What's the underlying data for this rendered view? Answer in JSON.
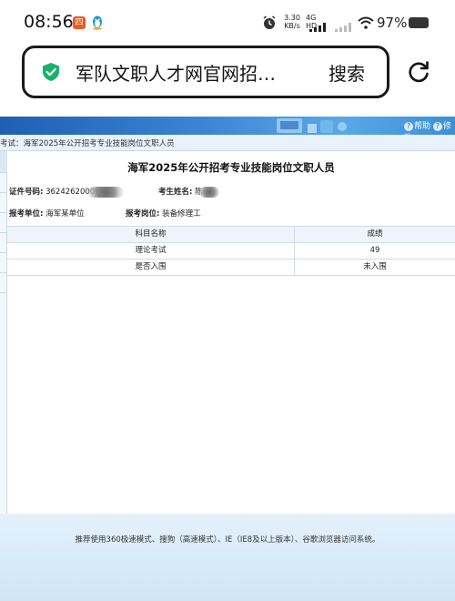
{
  "status_bar": {
    "time": "08:56",
    "app_badge_text": "四",
    "speed_value": "3.30",
    "speed_unit": "KB/s",
    "network_label": "4G HD",
    "battery_percent": "97%"
  },
  "browser": {
    "url_text": "军队文职人才网官网招…",
    "search_label": "搜索",
    "accent_color": "#18b36b"
  },
  "site": {
    "help_links": [
      "帮助",
      "修改"
    ]
  },
  "breadcrumb": {
    "text": "考试：海军2025年公开招考专业技能岗位文职人员"
  },
  "result": {
    "title": "海军2025年公开招考专业技能岗位文职人员",
    "id_label": "证件号码:",
    "id_value": "36242620009",
    "name_label": "考生姓名:",
    "name_value": "陈",
    "unit_label": "报考单位:",
    "unit_value": "海军某单位",
    "position_label": "报考岗位:",
    "position_value": "装备修理工",
    "table": {
      "headers": [
        "科目名称",
        "成绩"
      ],
      "rows": [
        [
          "理论考试",
          "49"
        ],
        [
          "是否入围",
          "未入围"
        ]
      ]
    }
  },
  "footer": {
    "text": "推荐使用360极速模式、搜狗（高速模式）、IE（IE8及以上版本）、谷歌浏览器访问系统。"
  }
}
